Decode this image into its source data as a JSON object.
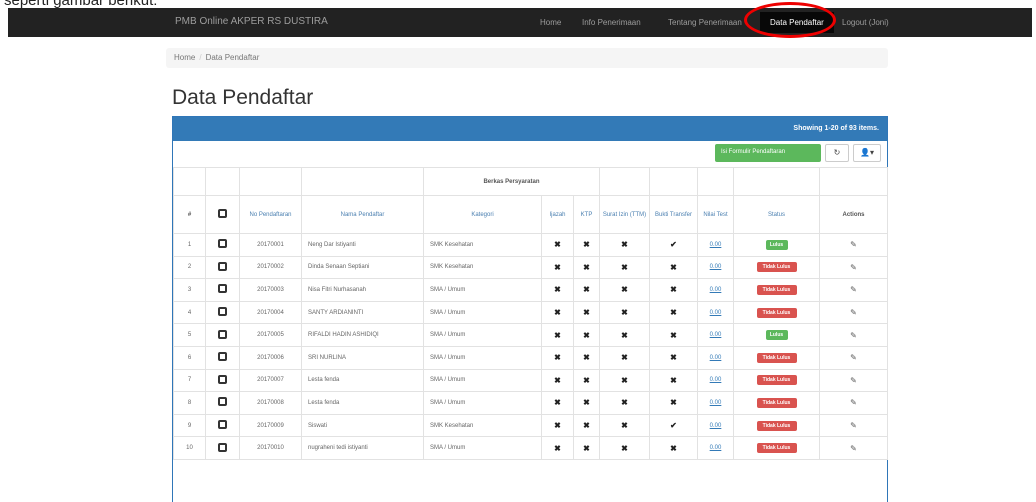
{
  "caption": "seperti gambar berikut:",
  "navbar": {
    "brand": "PMB Online AKPER RS DUSTIRA",
    "items": [
      "Home",
      "Info Penerimaan",
      "Tentang Penerimaan",
      "Data Pendaftar",
      "Logout (Joni)"
    ],
    "active_index": 3
  },
  "breadcrumb": [
    "Home",
    "Data Pendaftar"
  ],
  "title": "Data Pendaftar",
  "panel": {
    "showing": "Showing 1-20 of 93 items.",
    "add_button": "Isi Formulir Pendaftaran",
    "refresh_icon": "refresh-icon",
    "export_icon": "user-icon"
  },
  "table": {
    "group_header": "Berkas Persyaratan",
    "headers": [
      "#",
      "",
      "No Pendaftaran",
      "Nama Pendaftar",
      "Kategori",
      "Ijazah",
      "KTP",
      "Surat Izin (TTM)",
      "Bukti Transfer",
      "Nilai Test",
      "Status",
      "Actions"
    ],
    "rows": [
      {
        "no": "1",
        "reg": "20170001",
        "name": "Neng Dar Istiyanti",
        "kategori": "SMK Kesehatan",
        "ijazah": "✖",
        "ktp": "✖",
        "izin": "✖",
        "transfer": "✔",
        "nilai": "0.00",
        "status": "Lulus"
      },
      {
        "no": "2",
        "reg": "20170002",
        "name": "Dinda Senaan Septiani",
        "kategori": "SMK Kesehatan",
        "ijazah": "✖",
        "ktp": "✖",
        "izin": "✖",
        "transfer": "✖",
        "nilai": "0.00",
        "status": "Tidak Lulus"
      },
      {
        "no": "3",
        "reg": "20170003",
        "name": "Nisa Fitri Nurhasanah",
        "kategori": "SMA / Umum",
        "ijazah": "✖",
        "ktp": "✖",
        "izin": "✖",
        "transfer": "✖",
        "nilai": "0.00",
        "status": "Tidak Lulus"
      },
      {
        "no": "4",
        "reg": "20170004",
        "name": "SANTY ARDIANINTI",
        "kategori": "SMA / Umum",
        "ijazah": "✖",
        "ktp": "✖",
        "izin": "✖",
        "transfer": "✖",
        "nilai": "0.00",
        "status": "Tidak Lulus"
      },
      {
        "no": "5",
        "reg": "20170005",
        "name": "RIFALDI HADIN ASHIDIQI",
        "kategori": "SMA / Umum",
        "ijazah": "✖",
        "ktp": "✖",
        "izin": "✖",
        "transfer": "✖",
        "nilai": "0.00",
        "status": "Lulus"
      },
      {
        "no": "6",
        "reg": "20170006",
        "name": "SRI NURLINA",
        "kategori": "SMA / Umum",
        "ijazah": "✖",
        "ktp": "✖",
        "izin": "✖",
        "transfer": "✖",
        "nilai": "0.00",
        "status": "Tidak Lulus"
      },
      {
        "no": "7",
        "reg": "20170007",
        "name": "Lesta fenda",
        "kategori": "SMA / Umum",
        "ijazah": "✖",
        "ktp": "✖",
        "izin": "✖",
        "transfer": "✖",
        "nilai": "0.00",
        "status": "Tidak Lulus"
      },
      {
        "no": "8",
        "reg": "20170008",
        "name": "Lesta fenda",
        "kategori": "SMA / Umum",
        "ijazah": "✖",
        "ktp": "✖",
        "izin": "✖",
        "transfer": "✖",
        "nilai": "0.00",
        "status": "Tidak Lulus"
      },
      {
        "no": "9",
        "reg": "20170009",
        "name": "Siswati",
        "kategori": "SMK Kesehatan",
        "ijazah": "✖",
        "ktp": "✖",
        "izin": "✖",
        "transfer": "✔",
        "nilai": "0.00",
        "status": "Tidak Lulus"
      },
      {
        "no": "10",
        "reg": "20170010",
        "name": "nugraheni tedi istiyanti",
        "kategori": "SMA / Umum",
        "ijazah": "✖",
        "ktp": "✖",
        "izin": "✖",
        "transfer": "✖",
        "nilai": "0.00",
        "status": "Tidak Lulus"
      }
    ]
  }
}
